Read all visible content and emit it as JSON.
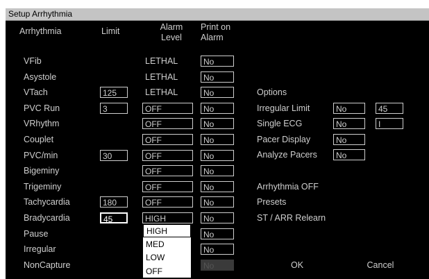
{
  "window": {
    "title": "Setup Arrhythmia"
  },
  "columns": {
    "arrhythmia": "Arrhythmia",
    "limit": "Limit",
    "alarm_level": "Alarm\nLevel",
    "print_on_alarm": "Print on\nAlarm"
  },
  "rows": [
    {
      "name": "VFib",
      "limit": null,
      "level": "LETHAL",
      "level_editable": false,
      "print": "No"
    },
    {
      "name": "Asystole",
      "limit": null,
      "level": "LETHAL",
      "level_editable": false,
      "print": "No"
    },
    {
      "name": "VTach",
      "limit": "125",
      "level": "LETHAL",
      "level_editable": false,
      "print": "No"
    },
    {
      "name": "PVC Run",
      "limit": "3",
      "level": "OFF",
      "level_editable": true,
      "print": "No"
    },
    {
      "name": "VRhythm",
      "limit": null,
      "level": "OFF",
      "level_editable": true,
      "print": "No"
    },
    {
      "name": "Couplet",
      "limit": null,
      "level": "OFF",
      "level_editable": true,
      "print": "No"
    },
    {
      "name": "PVC/min",
      "limit": "30",
      "level": "OFF",
      "level_editable": true,
      "print": "No"
    },
    {
      "name": "Bigeminy",
      "limit": null,
      "level": "OFF",
      "level_editable": true,
      "print": "No"
    },
    {
      "name": "Trigeminy",
      "limit": null,
      "level": "OFF",
      "level_editable": true,
      "print": "No"
    },
    {
      "name": "Tachycardia",
      "limit": "180",
      "level": "OFF",
      "level_editable": true,
      "print": "No"
    },
    {
      "name": "Bradycardia",
      "limit": "45",
      "level": "HIGH",
      "level_editable": true,
      "print": "No",
      "limit_selected": true
    },
    {
      "name": "Pause",
      "limit": null,
      "level": null,
      "level_editable": true,
      "print": "No"
    },
    {
      "name": "Irregular",
      "limit": null,
      "level": null,
      "level_editable": true,
      "print": "No"
    },
    {
      "name": "NonCapture",
      "limit": null,
      "level": null,
      "level_editable": true,
      "print": "No",
      "print_disabled": true
    }
  ],
  "options": {
    "heading": "Options",
    "irregular_limit": {
      "label": "Irregular Limit",
      "value": "No",
      "value2": "45"
    },
    "single_ecg": {
      "label": "Single ECG",
      "value": "No",
      "value2": "I"
    },
    "pacer_display": {
      "label": "Pacer Display",
      "value": "No"
    },
    "analyze_pacers": {
      "label": "Analyze Pacers",
      "value": "No"
    }
  },
  "actions": {
    "arrhythmia_off": "Arrhythmia OFF",
    "presets": "Presets",
    "st_arr_relearn": "ST / ARR Relearn",
    "ok": "OK",
    "cancel": "Cancel"
  },
  "level_dropdown": {
    "options": [
      "HIGH",
      "MED",
      "LOW",
      "OFF"
    ],
    "highlighted": "HIGH"
  }
}
